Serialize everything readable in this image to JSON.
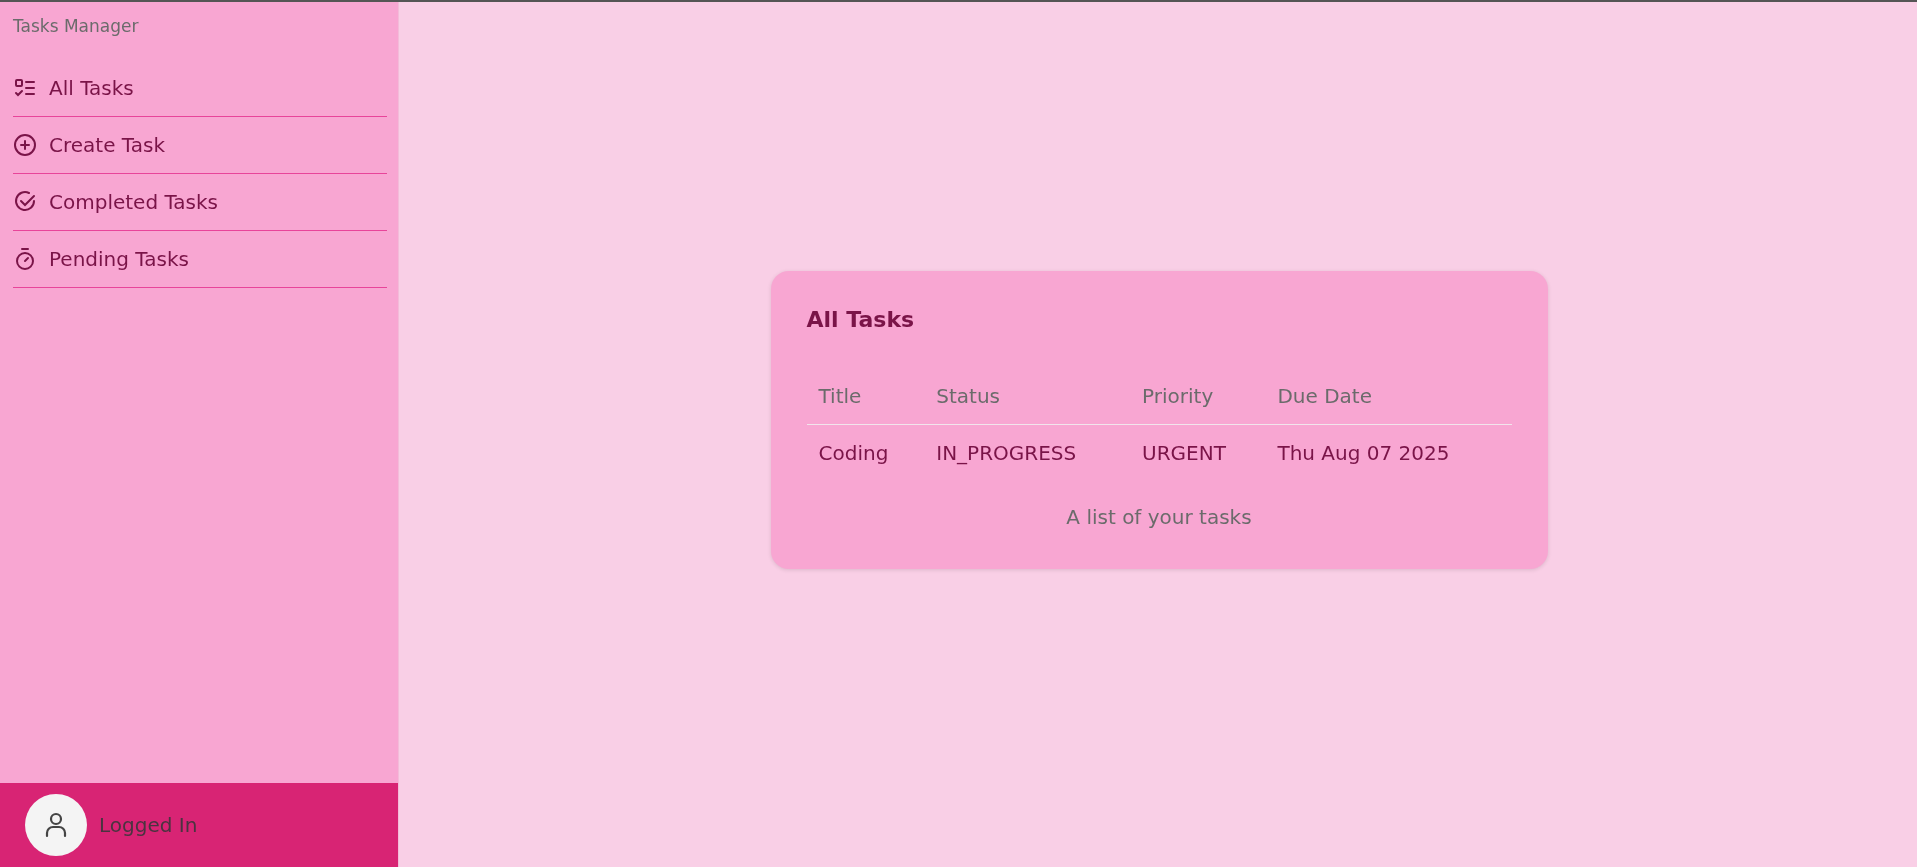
{
  "sidebar": {
    "title": "Tasks Manager",
    "items": [
      {
        "label": "All Tasks",
        "kind": "list"
      },
      {
        "label": "Create Task",
        "kind": "add"
      },
      {
        "label": "Completed Tasks",
        "kind": "check"
      },
      {
        "label": "Pending Tasks",
        "kind": "timer"
      }
    ],
    "footer": {
      "label": "Logged In"
    }
  },
  "card": {
    "title": "All Tasks",
    "table": {
      "columns": [
        "Title",
        "Status",
        "Priority",
        "Due Date"
      ],
      "rows": [
        [
          "Coding",
          "IN_PROGRESS",
          "URGENT",
          "Thu Aug 07 2025"
        ]
      ],
      "caption": "A list of your tasks"
    }
  }
}
